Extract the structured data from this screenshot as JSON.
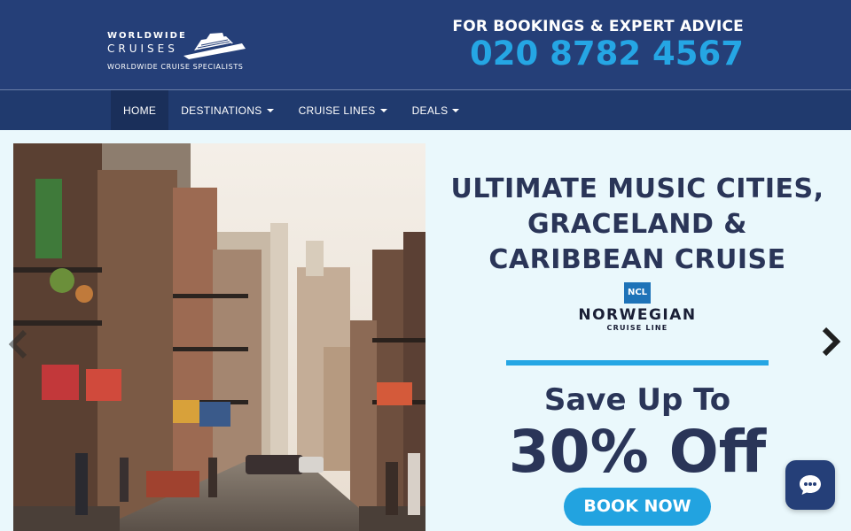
{
  "header": {
    "logo": {
      "line1": "WORLDWIDE",
      "line2": "CRUISES",
      "tagline": "WORLDWIDE CRUISE SPECIALISTS"
    },
    "contact_label": "FOR BOOKINGS & EXPERT ADVICE",
    "phone": "020 8782 4567"
  },
  "nav": {
    "items": [
      {
        "label": "HOME",
        "active": true,
        "dropdown": false
      },
      {
        "label": "DESTINATIONS",
        "active": false,
        "dropdown": true
      },
      {
        "label": "CRUISE LINES",
        "active": false,
        "dropdown": true
      },
      {
        "label": "DEALS",
        "active": false,
        "dropdown": true
      }
    ]
  },
  "hero": {
    "title_lines": [
      "ULTIMATE MUSIC CITIES,",
      "GRACELAND &",
      "CARIBBEAN CRUISE"
    ],
    "cruise_line": {
      "badge": "NCL",
      "name": "NORWEGIAN",
      "sub": "CRUISE LINE"
    },
    "save_text": "Save Up To",
    "discount_text": "30% Off",
    "cta_label": "BOOK NOW",
    "photo_icon": "city-street-photo"
  },
  "carousel": {
    "prev_icon": "chevron-left-icon",
    "next_icon": "chevron-right-icon"
  },
  "chat": {
    "icon": "chat-bubble-icon"
  },
  "colors": {
    "header_bg": "#253f78",
    "nav_bg": "#203a6e",
    "accent": "#25a6e4",
    "title_text": "#2a3558",
    "hero_bg": "#eaf8fc"
  }
}
